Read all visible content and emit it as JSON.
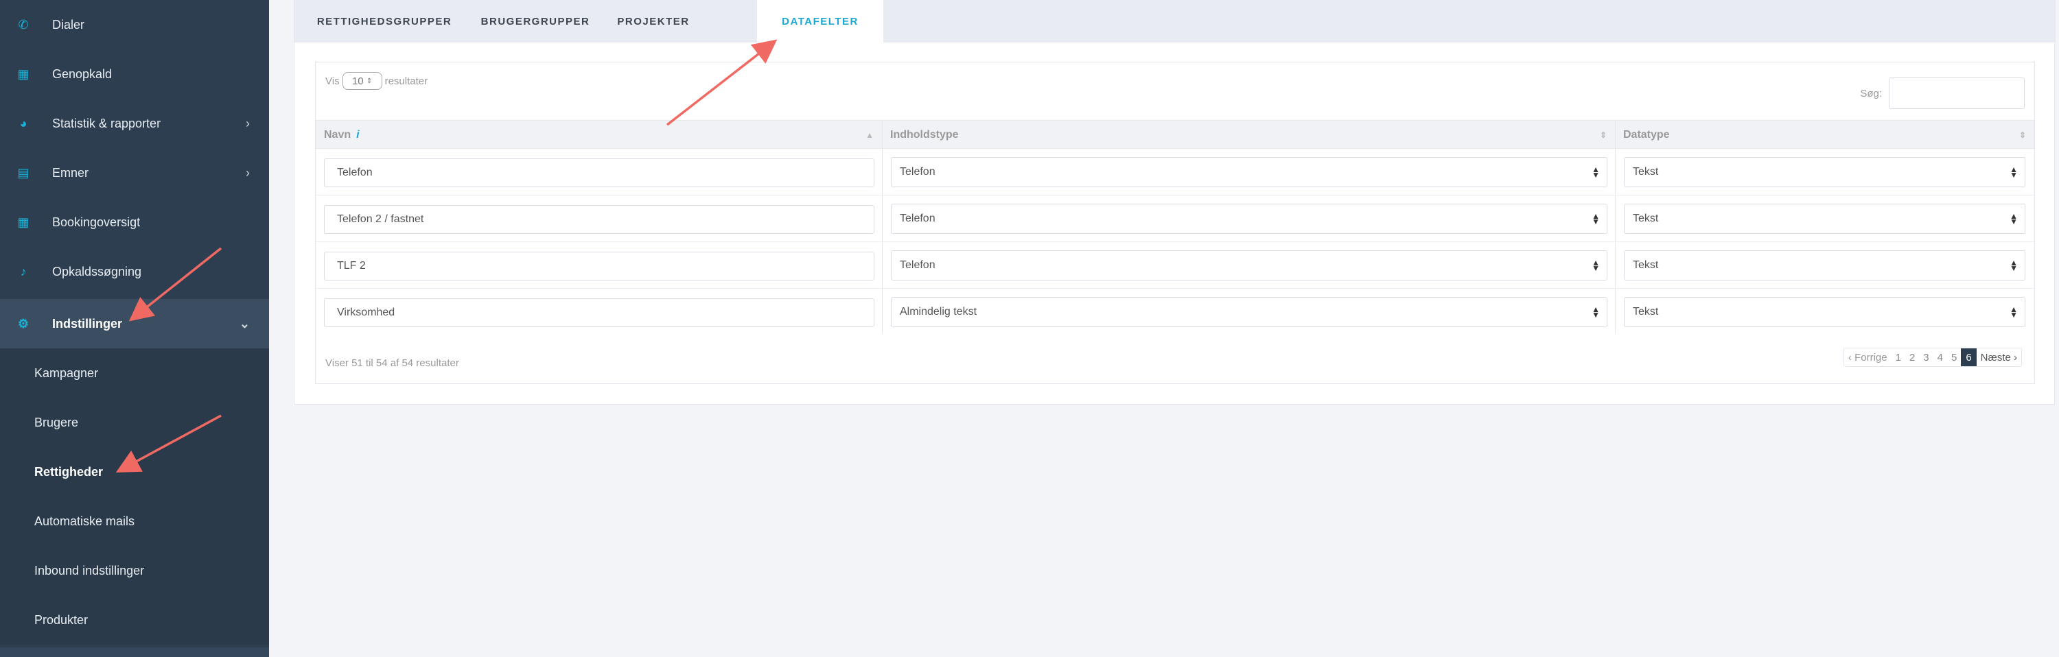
{
  "sidebar": {
    "items": [
      {
        "label": "Dialer",
        "icon": "phone-icon",
        "glyph": "✆"
      },
      {
        "label": "Genopkald",
        "icon": "calendar-icon",
        "glyph": "▦"
      },
      {
        "label": "Statistik & rapporter",
        "icon": "pie-chart-icon",
        "glyph": "◕",
        "chevron": "›"
      },
      {
        "label": "Emner",
        "icon": "archive-icon",
        "glyph": "▤",
        "chevron": "›"
      },
      {
        "label": "Bookingoversigt",
        "icon": "calendar-icon",
        "glyph": "▦"
      },
      {
        "label": "Opkaldssøgning",
        "icon": "microphone-icon",
        "glyph": "♪"
      },
      {
        "label": "Indstillinger",
        "icon": "gear-icon",
        "glyph": "⚙",
        "chevron": "⌄"
      }
    ],
    "subitems": [
      {
        "label": "Kampagner"
      },
      {
        "label": "Brugere"
      },
      {
        "label": "Rettigheder"
      },
      {
        "label": "Automatiske mails"
      },
      {
        "label": "Inbound indstillinger"
      },
      {
        "label": "Produkter"
      }
    ]
  },
  "tabs": [
    {
      "label": "RETTIGHEDSGRUPPER"
    },
    {
      "label": "BRUGERGRUPPER"
    },
    {
      "label": "PROJEKTER"
    },
    {
      "label": "DATAFELTER"
    }
  ],
  "table": {
    "length_prefix": "Vis",
    "length_value": "10",
    "length_suffix": "resultater",
    "search_label": "Søg:",
    "columns": [
      {
        "label": "Navn",
        "sort": "▲"
      },
      {
        "label": "Indholdstype",
        "sort": "⇕"
      },
      {
        "label": "Datatype",
        "sort": "⇕"
      }
    ],
    "info_glyph": "i",
    "rows": [
      {
        "name": "Telefon",
        "content_type": "Telefon",
        "data_type": "Tekst"
      },
      {
        "name": "Telefon 2 / fastnet",
        "content_type": "Telefon",
        "data_type": "Tekst"
      },
      {
        "name": "TLF 2",
        "content_type": "Telefon",
        "data_type": "Tekst"
      },
      {
        "name": "Virksomhed",
        "content_type": "Almindelig tekst",
        "data_type": "Tekst"
      }
    ],
    "info_text": "Viser 51 til 54 af 54 resultater",
    "pagination": {
      "prev": "‹  Forrige",
      "pages": [
        "1",
        "2",
        "3",
        "4",
        "5",
        "6"
      ],
      "current": "6",
      "next": "Næste  ›"
    }
  },
  "colors": {
    "sidebar_bg": "#2c3e50",
    "accent": "#1ba7cf",
    "annotation_arrow": "#f06a63"
  }
}
